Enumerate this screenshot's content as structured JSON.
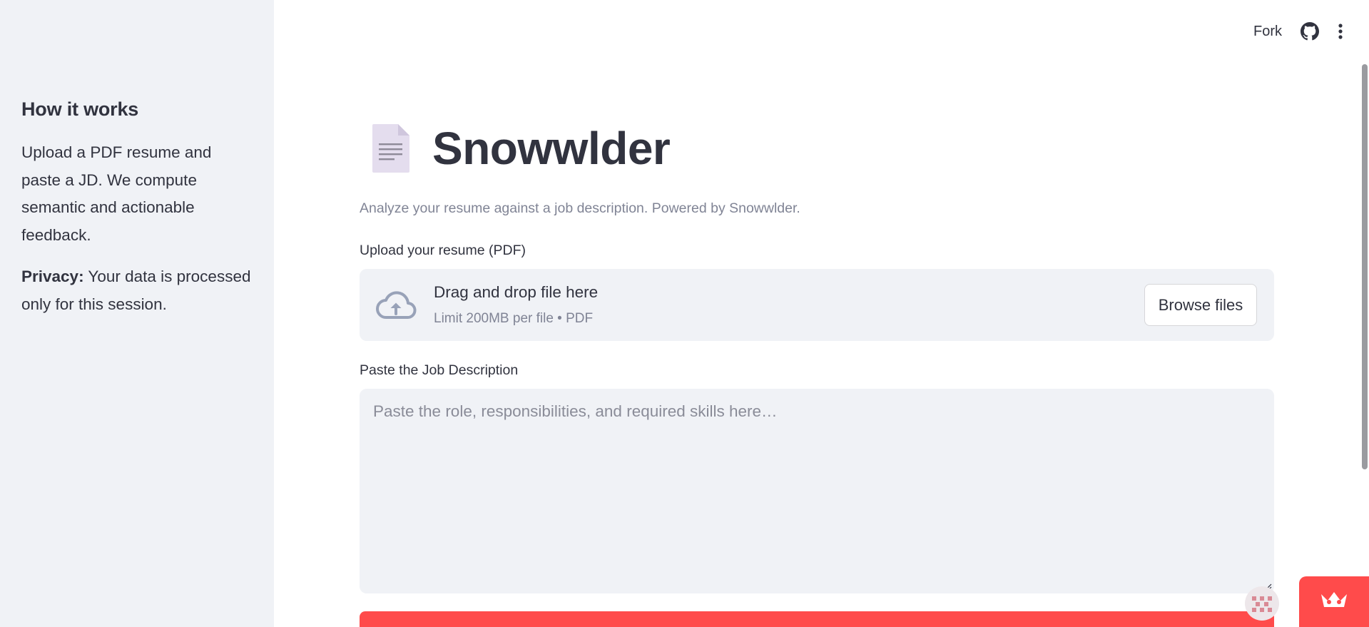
{
  "header": {
    "fork_label": "Fork",
    "github_icon": "github-icon",
    "menu_icon": "vertical-ellipsis-icon"
  },
  "sidebar": {
    "heading": "How it works",
    "description": "Upload a PDF resume and paste a JD. We compute semantic and actionable feedback.",
    "privacy_label": "Privacy:",
    "privacy_text": " Your data is processed only for this session."
  },
  "main": {
    "title_icon": "document-icon",
    "title": "Snowwlder",
    "subtitle": "Analyze your resume against a job description. Powered by Snowwlder.",
    "upload": {
      "label": "Upload your resume (PDF)",
      "icon": "cloud-upload-icon",
      "dropzone_title": "Drag and drop file here",
      "dropzone_limit": "Limit 200MB per file • PDF",
      "browse_label": "Browse files"
    },
    "job_description": {
      "label": "Paste the Job Description",
      "value": "",
      "placeholder": "Paste the role, responsibilities, and required skills here…"
    }
  },
  "colors": {
    "primary": "#FF4B4B",
    "sidebar_bg": "#F0F2F6",
    "text": "#31333F",
    "muted_text": "#808495"
  }
}
